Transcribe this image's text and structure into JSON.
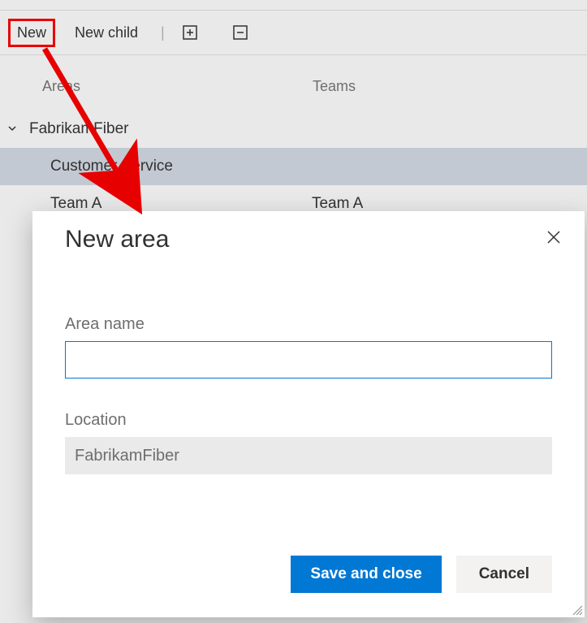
{
  "toolbar": {
    "new_label": "New",
    "new_child_label": "New child"
  },
  "columns": {
    "areas": "Areas",
    "teams": "Teams"
  },
  "tree": {
    "root": "FabrikamFiber",
    "items": [
      {
        "label": "Customer Service",
        "team": ""
      },
      {
        "label": "Team A",
        "team": "Team A"
      }
    ]
  },
  "dialog": {
    "title": "New area",
    "area_label": "Area name",
    "area_value": "",
    "location_label": "Location",
    "location_value": "FabrikamFiber",
    "save_label": "Save and close",
    "cancel_label": "Cancel"
  },
  "colors": {
    "primary": "#0078d4",
    "annotation": "#e60000"
  }
}
